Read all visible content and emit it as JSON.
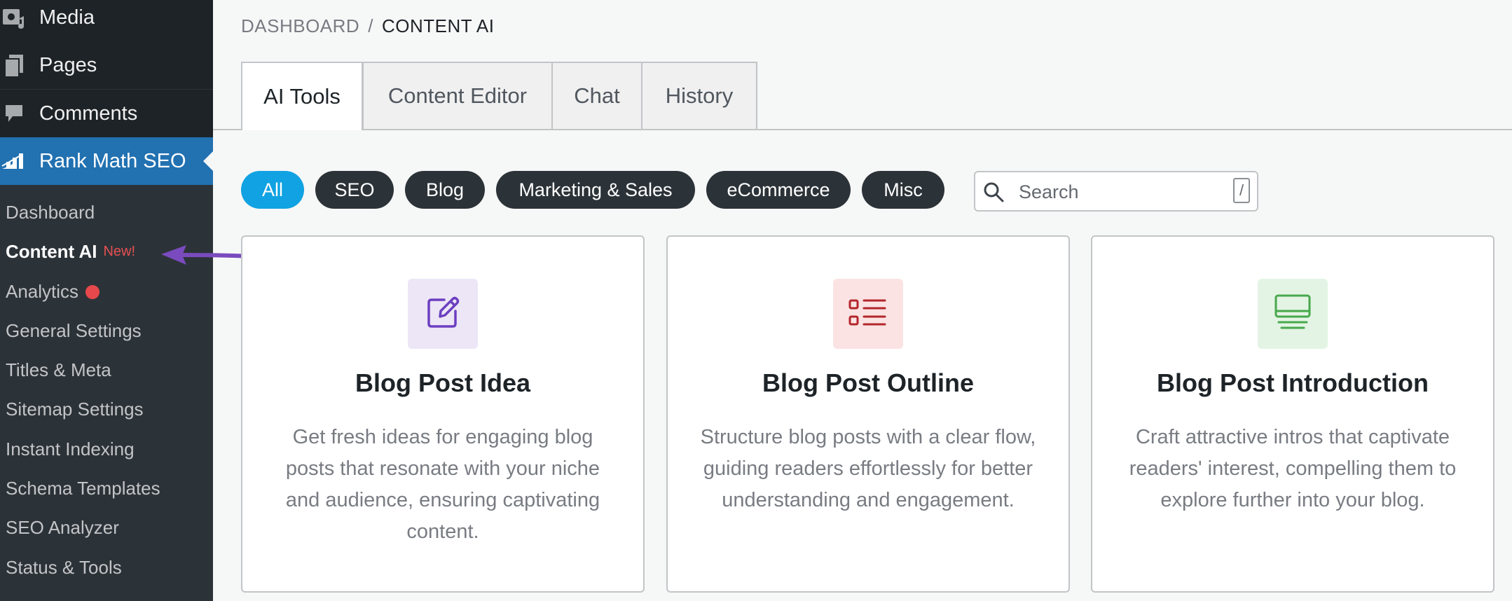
{
  "sidebar": {
    "top_items": [
      {
        "label": "Media",
        "icon": "media-icon"
      },
      {
        "label": "Pages",
        "icon": "pages-icon"
      },
      {
        "label": "Comments",
        "icon": "comments-icon"
      },
      {
        "label": "Rank Math SEO",
        "icon": "rank-math-icon"
      }
    ],
    "submenu": [
      {
        "label": "Dashboard"
      },
      {
        "label": "Content AI",
        "badge": "New!"
      },
      {
        "label": "Analytics"
      },
      {
        "label": "General Settings"
      },
      {
        "label": "Titles & Meta"
      },
      {
        "label": "Sitemap Settings"
      },
      {
        "label": "Instant Indexing"
      },
      {
        "label": "Schema Templates"
      },
      {
        "label": "SEO Analyzer"
      },
      {
        "label": "Status & Tools"
      }
    ]
  },
  "breadcrumb": {
    "parent": "DASHBOARD",
    "separator": "/",
    "current": "CONTENT AI"
  },
  "tabs": [
    {
      "label": "AI Tools",
      "active": true
    },
    {
      "label": "Content Editor"
    },
    {
      "label": "Chat"
    },
    {
      "label": "History"
    }
  ],
  "filters": [
    {
      "label": "All",
      "active": true
    },
    {
      "label": "SEO"
    },
    {
      "label": "Blog"
    },
    {
      "label": "Marketing & Sales"
    },
    {
      "label": "eCommerce"
    },
    {
      "label": "Misc"
    }
  ],
  "search": {
    "placeholder": "Search",
    "shortcut": "/"
  },
  "cards": [
    {
      "title": "Blog Post Idea",
      "description": "Get fresh ideas for engaging blog posts that resonate with your niche and audience, ensuring captivating content.",
      "icon": "edit-icon",
      "icon_color": "#6c3fc0",
      "tile_color": "#ece6f6"
    },
    {
      "title": "Blog Post Outline",
      "description": "Structure blog posts with a clear flow, guiding readers effortlessly for better understanding and engagement.",
      "icon": "list-icon",
      "icon_color": "#b3262b",
      "tile_color": "#fbe3e3"
    },
    {
      "title": "Blog Post Introduction",
      "description": "Craft attractive intros that captivate readers' interest, compelling them to explore further into your blog.",
      "icon": "screen-icon",
      "icon_color": "#47a84c",
      "tile_color": "#e3f4e4"
    }
  ],
  "colors": {
    "sidebar_bg": "#2c3338",
    "active_menu": "#2271b1",
    "filter_active": "#10a2e2",
    "filter_default": "#2c3338",
    "new_badge": "#e65054",
    "arrow": "#7a4bbf"
  }
}
